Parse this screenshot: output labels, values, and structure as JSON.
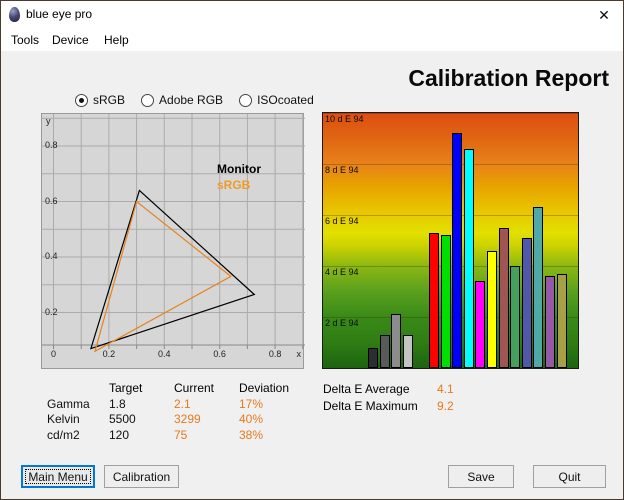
{
  "window": {
    "title": "blue eye pro",
    "close_glyph": "✕"
  },
  "menu": [
    {
      "label": "Tools"
    },
    {
      "label": "Device"
    },
    {
      "label": "Help"
    }
  ],
  "report_title": "Calibration Report",
  "radios": [
    {
      "label": "sRGB",
      "selected": true
    },
    {
      "label": "Adobe RGB",
      "selected": false
    },
    {
      "label": "ISOcoated",
      "selected": false
    }
  ],
  "stats": {
    "rows": [
      {
        "label": "Delta E Average",
        "value": "4.1"
      },
      {
        "label": "Delta E Maximum",
        "value": "9.2"
      }
    ]
  },
  "table": {
    "headers": [
      "",
      "Target",
      "Current",
      "Deviation"
    ],
    "rows": [
      [
        "Gamma",
        "1.8",
        "2.1",
        "17%"
      ],
      [
        "Kelvin",
        "5500",
        "3299",
        "40%"
      ],
      [
        "cd/m2",
        "120",
        "75",
        "38%"
      ]
    ]
  },
  "buttons": [
    {
      "label": "Main Menu"
    },
    {
      "label": "Calibration"
    },
    {
      "label": "Save"
    },
    {
      "label": "Quit"
    }
  ],
  "colors": {
    "accent_orange": "#e87a1e",
    "srgb_label_orange": "#f09b28",
    "monitor_label": "#000000"
  },
  "chart_data": [
    {
      "id": "cie-chromaticity-diagram",
      "type": "area",
      "title": "CIE 1931 xy chromaticity with gamut triangles",
      "x_axis_label": "x",
      "y_axis_label": "y",
      "xlim": [
        0,
        0.9
      ],
      "ylim": [
        0,
        0.9
      ],
      "grid": true,
      "grid_step": 0.1,
      "x_ticks": [
        "0",
        "0.2",
        "0.4",
        "0.6",
        "0.8"
      ],
      "y_ticks": [
        "0.8",
        "0.6",
        "0.4",
        "0.2"
      ],
      "series": [
        {
          "name": "Monitor",
          "color": "#000000",
          "points": [
            [
              0.725,
              0.265
            ],
            [
              0.31,
              0.64
            ],
            [
              0.135,
              0.07
            ]
          ]
        },
        {
          "name": "sRGB",
          "color": "#e8821e",
          "points": [
            [
              0.64,
              0.33
            ],
            [
              0.3,
              0.6
            ],
            [
              0.15,
              0.06
            ]
          ]
        }
      ]
    },
    {
      "id": "delta-e-bars",
      "type": "bar",
      "title": "Delta E 94 per patch",
      "ylim": [
        0,
        10
      ],
      "y_tick_labels": [
        "10 d E 94",
        "8 d E 94",
        "6 d E 94",
        "4 d E 94",
        "2 d E 94"
      ],
      "y_tick_values": [
        10,
        8,
        6,
        4,
        2
      ],
      "bars": [
        {
          "color": "#2e2e2e",
          "value": 0.8
        },
        {
          "color": "#5a5a5a",
          "value": 1.3
        },
        {
          "color": "#8c8c8c",
          "value": 2.1
        },
        {
          "color": "#c4c4c4",
          "value": 1.3
        },
        {
          "color": "#ff0000",
          "value": 5.3
        },
        {
          "color": "#00e000",
          "value": 5.2
        },
        {
          "color": "#0000ff",
          "value": 9.2
        },
        {
          "color": "#00ffff",
          "value": 8.6
        },
        {
          "color": "#ff00ff",
          "value": 3.4
        },
        {
          "color": "#ffff00",
          "value": 4.6
        },
        {
          "color": "#a05454",
          "value": 5.5
        },
        {
          "color": "#44a05c",
          "value": 4.0
        },
        {
          "color": "#5058a8",
          "value": 5.1
        },
        {
          "color": "#50a8a8",
          "value": 6.3
        },
        {
          "color": "#9858a8",
          "value": 3.6
        },
        {
          "color": "#a8a048",
          "value": 3.7
        }
      ],
      "summary": {
        "average": 4.1,
        "maximum": 9.2
      }
    }
  ]
}
